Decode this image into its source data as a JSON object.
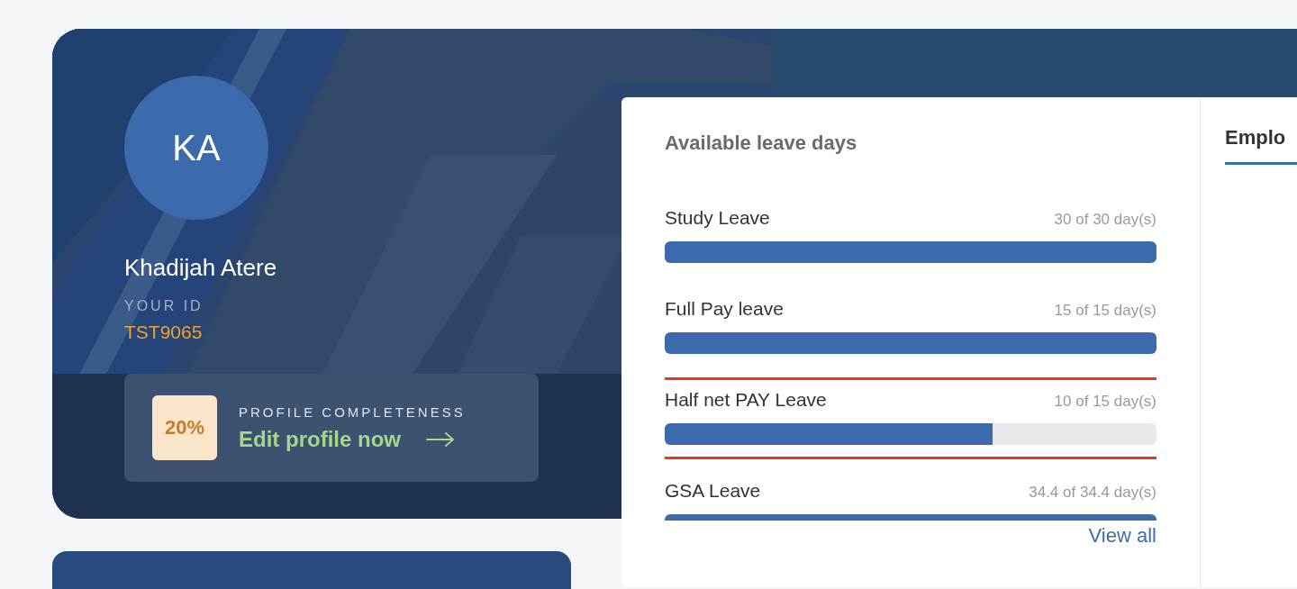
{
  "profile": {
    "initials": "KA",
    "name": "Khadijah Atere",
    "id_label": "YOUR ID",
    "id": "TST9065",
    "completeness": {
      "percent": "20%",
      "label": "PROFILE COMPLETENESS",
      "link": "Edit profile now"
    }
  },
  "leave": {
    "title": "Available leave days",
    "items": [
      {
        "name": "Study Leave",
        "reading": "30 of 30 day(s)",
        "level": 1,
        "highlighted": false
      },
      {
        "name": "Full Pay leave",
        "reading": "15 of 15 day(s)",
        "level": 1,
        "highlighted": false
      },
      {
        "name": "Half net PAY Leave",
        "reading": "10 of 15 day(s)",
        "level": 0.667,
        "highlighted": true
      },
      {
        "name": "GSA Leave",
        "reading": "34.4 of 34.4 day(s)",
        "level": 1,
        "highlighted": false
      }
    ],
    "view_all": "View all"
  },
  "tabs": [
    {
      "label": "Emplo",
      "selected": true
    }
  ]
}
